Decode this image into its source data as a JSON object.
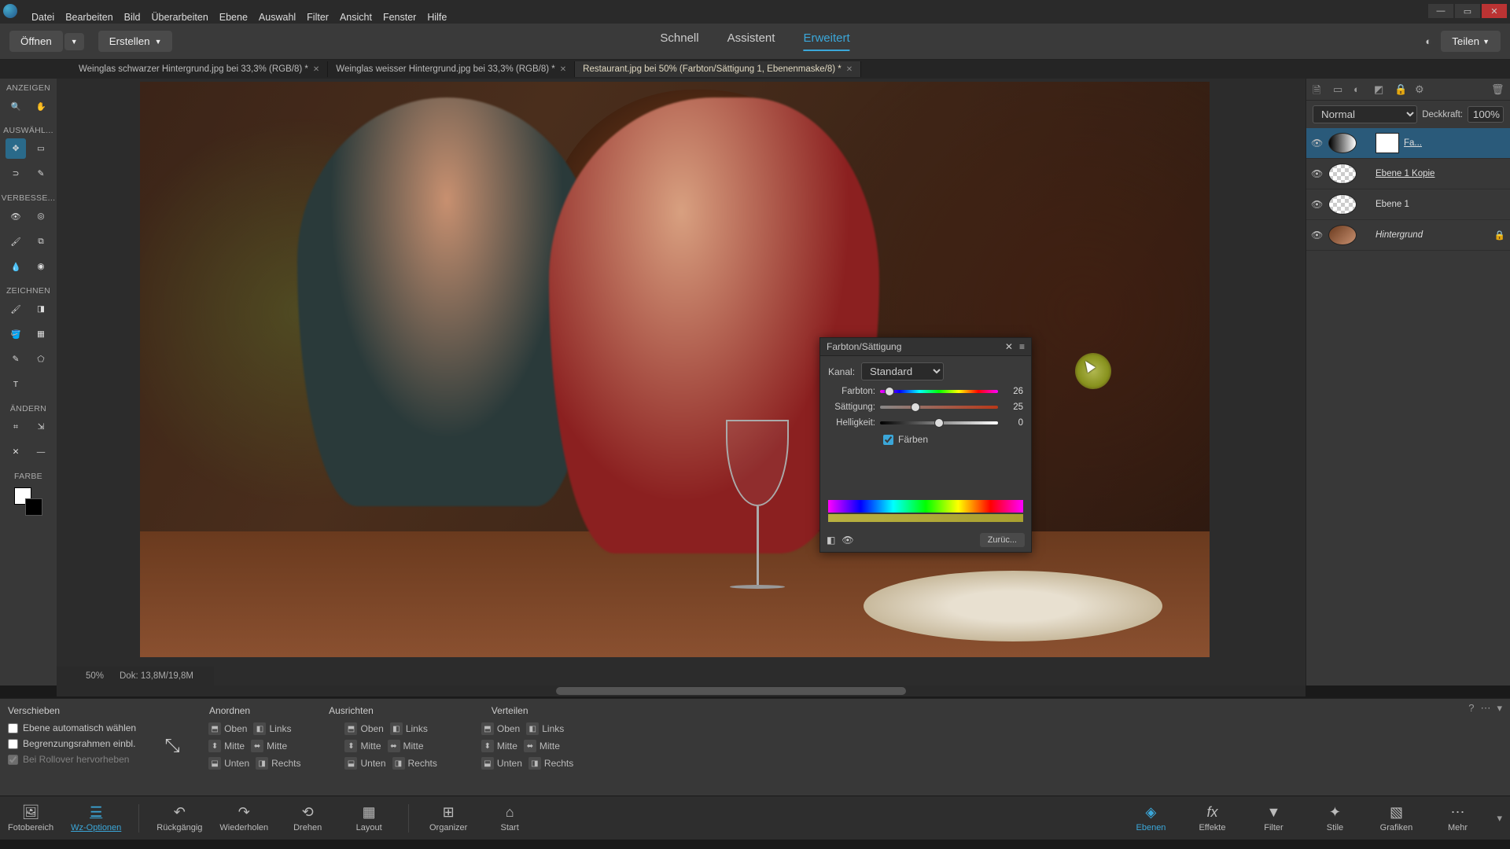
{
  "menu": {
    "datei": "Datei",
    "bearb": "Bearbeiten",
    "bild": "Bild",
    "ueber": "Überarbeiten",
    "ebene": "Ebene",
    "auswahl": "Auswahl",
    "filter": "Filter",
    "ansicht": "Ansicht",
    "fenster": "Fenster",
    "hilfe": "Hilfe"
  },
  "actionbar": {
    "open": "Öffnen",
    "create": "Erstellen",
    "mode_fast": "Schnell",
    "mode_assist": "Assistent",
    "mode_adv": "Erweitert",
    "share": "Teilen"
  },
  "tabs": {
    "t0": "Weinglas schwarzer Hintergrund.jpg bei 33,3% (RGB/8) *",
    "t1": "Weinglas weisser Hintergrund.jpg bei 33,3% (RGB/8) *",
    "t2": "Restaurant.jpg bei 50% (Farbton/Sättigung 1, Ebenenmaske/8) *"
  },
  "toolgroups": {
    "anzeigen": "ANZEIGEN",
    "auswaehl": "AUSWÄHL...",
    "verbesse": "VERBESSE...",
    "zeichnen": "ZEICHNEN",
    "aendern": "ÄNDERN",
    "farbe": "FARBE"
  },
  "hs": {
    "title": "Farbton/Sättigung",
    "kanal_label": "Kanal:",
    "kanal_val": "Standard",
    "farbton_label": "Farbton:",
    "farbton_val": "26",
    "saett_label": "Sättigung:",
    "saett_val": "25",
    "hell_label": "Helligkeit:",
    "hell_val": "0",
    "faerben": "Färben",
    "reset": "Zurüc..."
  },
  "layers": {
    "blend": "Normal",
    "opac_label": "Deckkraft:",
    "opac_val": "100%",
    "l0": "Fa...",
    "l1": "Ebene 1 Kopie",
    "l2": "Ebene 1",
    "l3": "Hintergrund"
  },
  "status": {
    "zoom": "50%",
    "doc": "Dok: 13,8M/19,8M"
  },
  "opts": {
    "title": "Verschieben",
    "c0": "Ebene automatisch wählen",
    "c1": "Begrenzungsrahmen einbl.",
    "c2": "Bei Rollover hervorheben",
    "g_anordnen": "Anordnen",
    "g_ausrichten": "Ausrichten",
    "g_verteilen": "Verteilen",
    "oben": "Oben",
    "mitte": "Mitte",
    "unten": "Unten",
    "links": "Links",
    "rechts": "Rechts"
  },
  "taskbar": {
    "foto": "Fotobereich",
    "wz": "Wz-Optionen",
    "undo": "Rückgängig",
    "redo": "Wiederholen",
    "drehen": "Drehen",
    "layout": "Layout",
    "organizer": "Organizer",
    "start": "Start",
    "ebenen": "Ebenen",
    "effekte": "Effekte",
    "filter": "Filter",
    "stile": "Stile",
    "grafiken": "Grafiken",
    "mehr": "Mehr"
  }
}
